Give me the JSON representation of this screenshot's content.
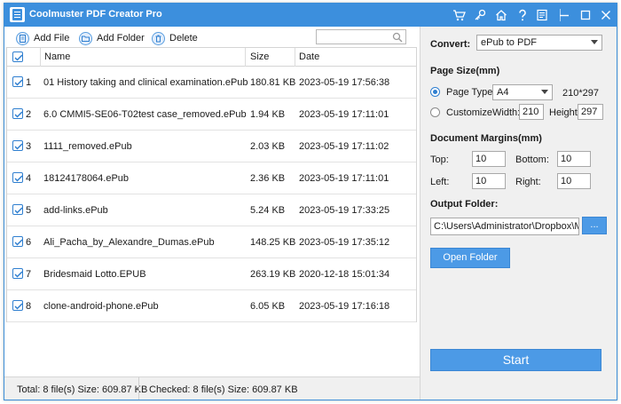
{
  "app": {
    "title": "Coolmuster PDF Creator Pro"
  },
  "titlebar_icons": [
    "cart-icon",
    "key-icon",
    "home-icon",
    "help-icon",
    "feedback-icon",
    "minimize-icon",
    "maximize-icon",
    "close-icon"
  ],
  "toolbar": {
    "add_file": "Add File",
    "add_folder": "Add Folder",
    "delete": "Delete",
    "search_value": ""
  },
  "list": {
    "columns": {
      "name": "Name",
      "size": "Size",
      "date": "Date"
    },
    "rows": [
      {
        "index": "1",
        "name": "01 History taking and clinical examination.ePub",
        "size": "180.81 KB",
        "date": "2023-05-19 17:56:38"
      },
      {
        "index": "2",
        "name": "6.0 CMMI5-SE06-T02test case_removed.ePub",
        "size": "1.94 KB",
        "date": "2023-05-19 17:11:01"
      },
      {
        "index": "3",
        "name": "1111_removed.ePub",
        "size": "2.03 KB",
        "date": "2023-05-19 17:11:02"
      },
      {
        "index": "4",
        "name": "18124178064.ePub",
        "size": "2.36 KB",
        "date": "2023-05-19 17:11:01"
      },
      {
        "index": "5",
        "name": "add-links.ePub",
        "size": "5.24 KB",
        "date": "2023-05-19 17:33:25"
      },
      {
        "index": "6",
        "name": "Ali_Pacha_by_Alexandre_Dumas.ePub",
        "size": "148.25 KB",
        "date": "2023-05-19 17:35:12"
      },
      {
        "index": "7",
        "name": "Bridesmaid Lotto.EPUB",
        "size": "263.19 KB",
        "date": "2020-12-18 15:01:34"
      },
      {
        "index": "8",
        "name": "clone-android-phone.ePub",
        "size": "6.05 KB",
        "date": "2023-05-19 17:16:18"
      }
    ]
  },
  "status": {
    "total": "Total: 8 file(s) Size: 609.87 KB",
    "checked": "Checked: 8 file(s) Size: 609.87 KB"
  },
  "panel": {
    "convert_label": "Convert:",
    "convert_value": "ePub to PDF",
    "page_size_title": "Page Size(mm)",
    "page_type_label": "Page Type",
    "page_type_value": "A4",
    "page_type_dims": "210*297",
    "customize_label": "Customize",
    "width_label": "Width:",
    "width_value": "210",
    "height_label": "Height:",
    "height_value": "297",
    "margins_title": "Document Margins(mm)",
    "top_label": "Top:",
    "top_value": "10",
    "bottom_label": "Bottom:",
    "bottom_value": "10",
    "left_label": "Left:",
    "left_value": "10",
    "right_label": "Right:",
    "right_value": "10",
    "output_title": "Output Folder:",
    "output_path": "C:\\Users\\Administrator\\Dropbox\\M",
    "browse_label": "...",
    "open_folder_label": "Open Folder",
    "start_label": "Start"
  },
  "colors": {
    "titlebar": "#3c8fdd",
    "button": "#4c9ae6",
    "accent": "#2f7fd0"
  }
}
